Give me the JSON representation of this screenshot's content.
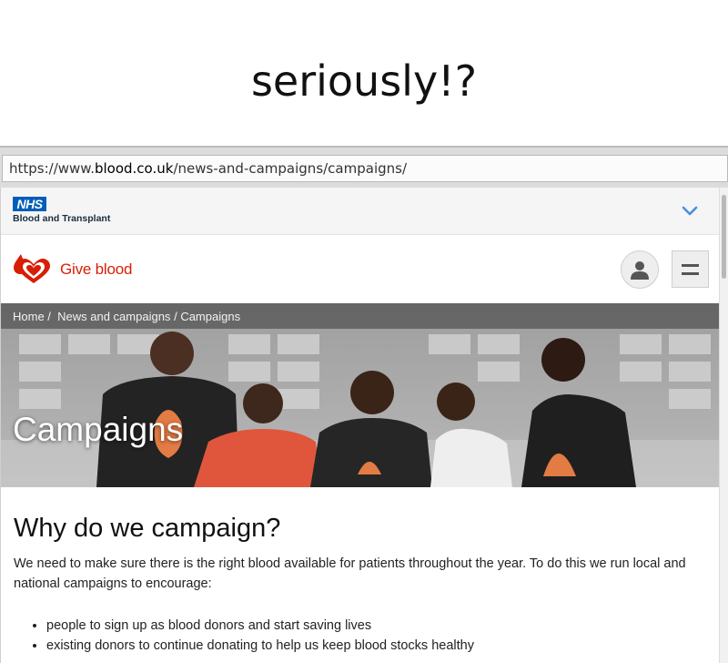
{
  "caption": "seriously!?",
  "browser": {
    "url_prefix": "https://www.",
    "url_domain": "blood.co.uk",
    "url_path": "/news-and-campaigns/campaigns/"
  },
  "nhs": {
    "logo": "NHS",
    "org": "Blood and Transplant"
  },
  "header": {
    "brand": "Give blood"
  },
  "breadcrumb": {
    "home": "Home /",
    "section": "News and campaigns",
    "sep": "/",
    "current": "Campaigns"
  },
  "hero": {
    "title": "Campaigns"
  },
  "main": {
    "heading": "Why do we campaign?",
    "intro": "We need to make sure there is the right blood available for patients throughout the year. To do this we run local and national campaigns to encourage:",
    "bullets": [
      "people to sign up as blood donors and start saving lives",
      "existing donors to continue donating to help us keep blood stocks healthy"
    ]
  },
  "colors": {
    "nhs_blue": "#005eb8",
    "brand_red": "#d81e05"
  },
  "icons": {
    "expand": "chevron-down-icon",
    "account": "user-icon",
    "menu": "hamburger-menu-icon",
    "logo": "blood-drop-hearts-icon"
  }
}
